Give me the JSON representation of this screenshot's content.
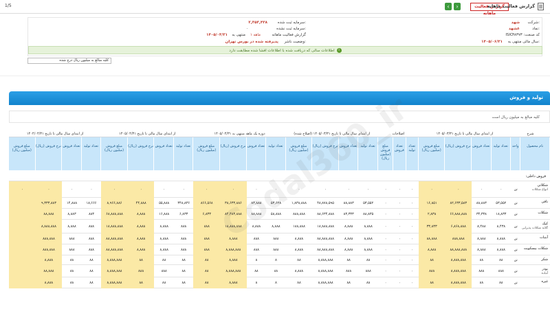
{
  "topbar": {
    "title": "گزارش فعالیت ماهانه",
    "report_button": "گزارش فعالیت ماهانه",
    "corner_text": "1/5"
  },
  "info": {
    "company_label": "شرکت:",
    "company_value": "شهد",
    "symbol_label": "نماد:",
    "symbol_value": "غشهد",
    "code_label": "کد صنعت: ۳۸۳۷۳",
    "isic_label": "ISIC",
    "code_value": "۳۸۳۷۳",
    "period_label": "سال مالی منتهی به:",
    "period_value": "۱۴۰۵/۰۶/۳۱",
    "registered_capital_label": "سرمایه ثبت شده:",
    "registered_capital_value": "۲,۳۵۳,۴۳۸",
    "unregistered_capital_label": "سرمایه ثبت نشده:",
    "unregistered_capital_value": "۰",
    "report_label": "گزارش فعالیت ماهانه",
    "month_label": "۱ ماهه",
    "period_to_label": "منتهی به",
    "period_to_value": "۱۴۰۵/۰۴/۳۱",
    "status_label": "وضعیت ناشر:",
    "status_value": "پذیرفته شده در بورس تهران"
  },
  "notice": "اطلاعات سالی که دریافت شده با اطلاعات افشا شده مطابقت دارد",
  "unit_select": "کلیه مبالغ به میلیون ریال درج شده",
  "section": {
    "title": "تولید و فروش",
    "note": "کلیه مبالغ به میلیون ریال است"
  },
  "table": {
    "group_headers": [
      "شرح",
      "از ابتدای سال مالی تا تاریخ ۱۴۰۵/۰۳/۳۱",
      "اصلاحات",
      "از ابتدای سال مالی تا تاریخ ۱۴۰۵/۰۳/۳۱ (اصلاح شده)",
      "دوره یک ماهه منتهی به ۱۴۰۵/۰۴/۳۱",
      "از ابتدای سال مالی تا تاریخ ۱۴۰۵/۰۴/۳۱",
      "از ابتدای سال مالی تا تاریخ ۱۴۰۴/۰۴/۳۱"
    ],
    "columns": [
      "نام محصول",
      "واحد",
      "تعداد تولید",
      "تعداد فروش",
      "نرخ فروش (ریال)",
      "مبلغ فروش (میلیون ریال)",
      "تعداد تولید",
      "تعداد فروش",
      "مبلغ فروش (میلیون ریال)",
      "تعداد تولید",
      "تعداد فروش",
      "نرخ فروش (ریال)",
      "مبلغ فروش (میلیون ریال)",
      "تعداد تولید",
      "تعداد فروش",
      "نرخ فروش (ریال)",
      "مبلغ فروش (میلیون ریال)",
      "تعداد تولید",
      "تعداد فروش",
      "نرخ فروش (ریال)",
      "مبلغ فروش (میلیون ریال)",
      "تعداد تولید",
      "تعداد فروش",
      "نرخ فروش (ریال)",
      "مبلغ فروش (میلیون ریال)"
    ],
    "section_label": "فروش داخلی:",
    "rows": [
      {
        "name": "شکلاتی",
        "sub": "انواع شکلات",
        "unit": "تن",
        "v": [
          "۰",
          "۰",
          "۰",
          "۰",
          "۰",
          "۰",
          "۰",
          "۰",
          "۰",
          "۰",
          "۰",
          "۰",
          "۰",
          "۰",
          "۰",
          "۰",
          "۰",
          "۰",
          "۰",
          "۰",
          "۰",
          "۰",
          "۰"
        ]
      },
      {
        "name": "تافی",
        "sub": "",
        "unit": "تن",
        "v": [
          "۵۳,۵۵۲",
          "۸۸,۸۸۳",
          "۸۲,۶۳۳,۵۸۳",
          "۱۶,۸۵۱",
          "۰",
          "۰",
          "۰",
          "۵۳,۵۵۲",
          "۸۸,۸۸۳",
          "۴۸,۸۷۸,۵۹۵",
          "۱,۸۳۸,۸۸۸",
          "۵۳,۶۲۸",
          "۸۳,۸۸۸",
          "۳۸,۶۳۳,۸۸۶",
          "۸۶۶,۵۶۸",
          "۳۴۸,۸۳۶",
          "۵۵,۸۸۸",
          "۴۴,۸۸۸",
          "۸,۹۶۶,۸۸۶",
          "۱۸,۶۶۶",
          "۱۴,۸۸۸",
          "۹,۳۳۳,۸۸۳"
        ]
      },
      {
        "name": "شکلات",
        "sub": "",
        "unit": "تن",
        "v": [
          "۱۸,۸۳۳",
          "۳۴,۳۳۸",
          "۶۶,۸۸۸,۸۸۸",
          "۲,۸۳۸",
          "۰",
          "۰",
          "۰",
          "۸۸,۸۳۵",
          "۸۳,۳۳۳",
          "۸۸,۶۳۴,۸۸۸",
          "۸۸۸,۸۸۸",
          "۵۸,۸۸۸",
          "۸۸,۸۸۸",
          "۸۴,۴۸۳,۸۸۸",
          "۶,۸۳۳",
          "۶,۸۳۳",
          "۱۶,۸۸۸",
          "۸,۸۸۸",
          "۶۸,۸۸۸,۸۸۸",
          "۸۸۳",
          "۸,۸۸۳",
          "۸۸,۸۸۸"
        ]
      },
      {
        "name": "کیک",
        "sub": "گلابه شکلات پذیرایی",
        "unit": "تن",
        "v": [
          "۸,۴۳۸",
          "۸,۴۸۸",
          "۶,۸۶۸,۸۸۸",
          "۳۳,۸۳۳",
          "۰",
          "۰",
          "۰",
          "۸,۸۸۸",
          "۸,۸۸۸",
          "۱۸,۸۸۸,۸۸۸",
          "۱۸۸,۸۸۸",
          "۸,۸۸۸",
          "۸,۸۸۸",
          "۱۸,۸۸۸,۸۸۸",
          "۸۸۸",
          "۸۸۸",
          "۸,۸۸۸",
          "۸,۸۸۸",
          "۱۸,۸۸۸,۸۸۸",
          "۸۸۸",
          "۸,۸۸۸",
          "۸,۸۸۸,۸۸۸"
        ]
      },
      {
        "name": "آبنبات",
        "sub": "",
        "unit": "تن",
        "v": [
          "۸,۸۸۸",
          "۸,۸۸۸",
          "۸۸۸,۸۸۸",
          "۸۸,۸۸۸",
          "۰",
          "۰",
          "۰",
          "۸,۸۸۸",
          "۸,۸۸۸",
          "۸۸,۸۸۸,۸۸۸",
          "۸,۸۸۸",
          "۸۸۸",
          "۸۸۸",
          "۸,۸۸۸",
          "۸۸۸",
          "۸۸۸",
          "۸,۸۸۸",
          "۸,۸۸۸",
          "۸۸,۸۸۸,۸۸۸",
          "۸۸۸",
          "۸۸۸",
          "۸۸۸,۸۸۸"
        ]
      },
      {
        "name": "شکلات بیسکویت",
        "sub": "",
        "unit": "تن",
        "v": [
          "۸,۸۸۸",
          "۸,۸۸۸",
          "۸۸,۸۸۸,۸۸۸",
          "۸,۸۸۸",
          "۰",
          "۰",
          "۰",
          "۸,۸۸۸",
          "۸,۸۸۸",
          "۸۸,۸۸۸,۸۸۸",
          "۸,۸۸۸",
          "۸۸۸",
          "۸۸۸",
          "۸,۸۸۸,۸۸۸",
          "۸۸۸",
          "۸۸۸",
          "۸,۸۸۸",
          "۸,۸۸۸",
          "۸۸,۸۸۸,۸۸۸",
          "۸۸۸",
          "۸۸۸",
          "۸۸۸,۸۸۸"
        ]
      },
      {
        "name": "شکر",
        "sub": "",
        "unit": "تن",
        "v": [
          "۸۸",
          "۸۸",
          "۸,۸۸۸,۸۸۸",
          "۸۸",
          "۰",
          "۰",
          "۰",
          "۸۸",
          "۸۸",
          "۸,۸۸۸,۸۸۸",
          "۸۸",
          "۸",
          "۸",
          "۸,۸۸۸",
          "۸۸",
          "۸۸",
          "۸۸",
          "۸۸",
          "۸,۸۸۸,۸۸۸",
          "۸۸",
          "۸۸",
          "۸,۸۸۸"
        ]
      },
      {
        "name": "پودر",
        "sub": "آماده",
        "unit": "تن",
        "v": [
          "۸۸۸",
          "۸۸۸",
          "۸,۸۸۸,۸۸۸",
          "۸۸۸",
          "۰",
          "۰",
          "۰",
          "۸۸۸",
          "۸۸۸",
          "۸,۸۸۸,۸۸۸",
          "۸,۸۸۸",
          "۸۸",
          "۸۸",
          "۸,۸۸۸,۸۸۸",
          "۸۸",
          "۸۸",
          "۸۸۸",
          "۸۸۸",
          "۸,۸۸۸,۸۸۸",
          "۸۸",
          "۸۸",
          "۸۸,۸۸۸"
        ]
      },
      {
        "name": "غیره",
        "sub": "",
        "unit": "تن",
        "v": [
          "۸۸",
          "۸۸",
          "۸,۸۸۸,۸۸۸",
          "۸۸",
          "۰",
          "۰",
          "۰",
          "۸۸",
          "۸۸",
          "۸,۸۸۸,۸۸۸",
          "۸۸",
          "۸",
          "۸",
          "۸,۸۸۸",
          "۸۸",
          "۸۸",
          "۸۸",
          "۸۸",
          "۸,۸۸۸,۸۸۸",
          "۸۸",
          "۸۸",
          "۸,۸۸۸"
        ]
      }
    ]
  },
  "colors": {
    "header_blue": "#1b8fd9",
    "highlight_yellow": "#fbe9a6",
    "notice_green": "#e6f2da"
  }
}
